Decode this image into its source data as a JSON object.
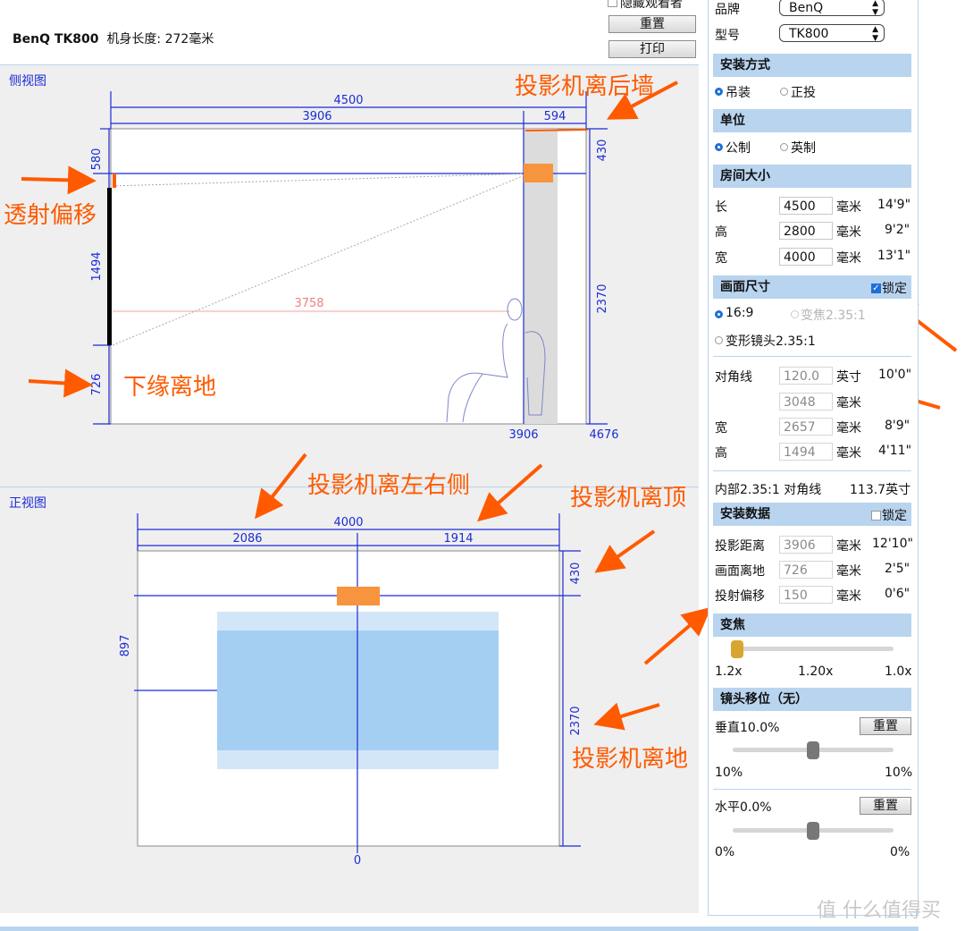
{
  "header": {
    "model_line": "BenQ TK800",
    "body_length": "机身长度: 272毫米",
    "hide_viewer": "隐藏观看者",
    "reset": "重置",
    "print": "打印"
  },
  "side_view": {
    "title": "侧视图",
    "dims": {
      "room_length": "4500",
      "seg_a": "3906",
      "seg_b": "594",
      "top_gap": "580",
      "screen_h": "1494",
      "bottom": "726",
      "ceiling_gap": "430",
      "floor_h": "2370",
      "distance": "3758",
      "x_mark1": "3906",
      "x_mark2": "4676"
    }
  },
  "front_view": {
    "title": "正视图",
    "dims": {
      "width": "4000",
      "left": "2086",
      "right": "1914",
      "top": "430",
      "floor": "2370",
      "left_h": "897",
      "zero": "0"
    }
  },
  "annotations": {
    "rear_wall": "投影机离后墙",
    "offset": "透射偏移",
    "bottom_edge": "下缘离地",
    "sides": "投影机离左右侧",
    "top": "投影机离顶",
    "floor": "投影机离地"
  },
  "panel": {
    "brand_label": "品牌",
    "brand_value": "BenQ",
    "model_label": "型号",
    "model_value": "TK800",
    "mount": {
      "title": "安装方式",
      "options": [
        "吊装",
        "正投"
      ]
    },
    "unit": {
      "title": "单位",
      "options": [
        "公制",
        "英制"
      ]
    },
    "room": {
      "title": "房间大小",
      "rows": [
        {
          "label": "长",
          "value": "4500",
          "unit": "毫米",
          "imperial": "14'9\""
        },
        {
          "label": "高",
          "value": "2800",
          "unit": "毫米",
          "imperial": "9'2\""
        },
        {
          "label": "宽",
          "value": "4000",
          "unit": "毫米",
          "imperial": "13'1\""
        }
      ]
    },
    "screen": {
      "title": "画面尺寸",
      "lock": "锁定",
      "opt_169": "16:9",
      "opt_zoom": "变焦2.35:1",
      "opt_anamorphic": "变形镜头2.35:1",
      "diag_label": "对角线",
      "diag_value": "120.0",
      "diag_unit": "英寸",
      "diag_imperial": "10'0\"",
      "diag_mm": "3048",
      "mm": "毫米",
      "w_label": "宽",
      "w_value": "2657",
      "w_imperial": "8'9\"",
      "h_label": "高",
      "h_value": "1494",
      "h_imperial": "4'11\"",
      "inner_label": "内部2.35:1 对角线",
      "inner_value": "113.7英寸"
    },
    "install": {
      "title": "安装数据",
      "lock": "锁定",
      "rows": [
        {
          "label": "投影距离",
          "value": "3906",
          "unit": "毫米",
          "imperial": "12'10\""
        },
        {
          "label": "画面离地",
          "value": "726",
          "unit": "毫米",
          "imperial": "2'5\""
        },
        {
          "label": "投射偏移",
          "value": "150",
          "unit": "毫米",
          "imperial": "0'6\""
        }
      ]
    },
    "zoom": {
      "title": "变焦",
      "min": "1.2x",
      "current": "1.20x",
      "max": "1.0x",
      "position": 0.0
    },
    "lens_shift": {
      "title": "镜头移位（无）",
      "vertical_label": "垂直10.0%",
      "reset": "重置",
      "v_min": "10%",
      "v_max": "10%",
      "v_position": 0.5,
      "horizontal_label": "水平0.0%",
      "h_min": "0%",
      "h_max": "0%",
      "h_position": 0.5
    }
  },
  "watermark": "值 什么值得买",
  "colors": {
    "dim_blue": "#1b2bd6",
    "section": "#b9d4ef",
    "orange": "#ff5a00",
    "projector": "#f7943e",
    "screen_blue": "#a4cff2"
  }
}
